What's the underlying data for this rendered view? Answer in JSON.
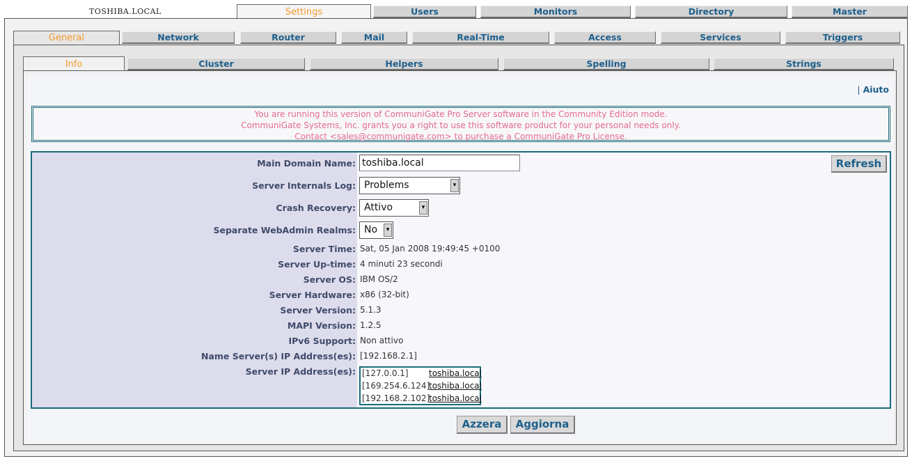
{
  "host": "TOSHIBA.LOCAL",
  "top_tabs": [
    {
      "label": "Settings",
      "active": true
    },
    {
      "label": "Users"
    },
    {
      "label": "Monitors"
    },
    {
      "label": "Directory"
    },
    {
      "label": "Master"
    }
  ],
  "second_tabs": [
    {
      "label": "General",
      "active": true
    },
    {
      "label": "Network"
    },
    {
      "label": "Router"
    },
    {
      "label": "Mail"
    },
    {
      "label": "Real-Time"
    },
    {
      "label": "Access"
    },
    {
      "label": "Services"
    },
    {
      "label": "Triggers"
    }
  ],
  "third_tabs": [
    {
      "label": "Info",
      "active": true
    },
    {
      "label": "Cluster"
    },
    {
      "label": "Helpers"
    },
    {
      "label": "Spelling"
    },
    {
      "label": "Strings"
    }
  ],
  "help": {
    "separator": "|",
    "label": "Aiuto"
  },
  "notice": {
    "line1": "You are running this version of CommuniGate Pro Server software in the Community Edition mode.",
    "line2": "CommuniGate Systems, Inc. grants you a right to use this software product for your personal needs only.",
    "line3": "Contact <sales@communigate.com> to purchase a CommuniGate Pro License."
  },
  "form": {
    "main_domain": {
      "label": "Main Domain Name:",
      "value": "toshiba.local"
    },
    "internals_log": {
      "label": "Server Internals Log:",
      "value": "Problems"
    },
    "crash_recovery": {
      "label": "Crash Recovery:",
      "value": "Attivo"
    },
    "webadmin_realms": {
      "label": "Separate WebAdmin Realms:",
      "value": "No"
    },
    "server_time": {
      "label": "Server Time:",
      "value": "Sat, 05 Jan 2008 19:49:45 +0100"
    },
    "uptime": {
      "label": "Server Up-time:",
      "value": "4 minuti 23 secondi"
    },
    "os": {
      "label": "Server OS:",
      "value": "IBM OS/2"
    },
    "hardware": {
      "label": "Server Hardware:",
      "value": "x86 (32-bit)"
    },
    "version": {
      "label": "Server Version:",
      "value": "5.1.3"
    },
    "mapi": {
      "label": "MAPI Version:",
      "value": "1.2.5"
    },
    "ipv6": {
      "label": "IPv6 Support:",
      "value": "Non attivo"
    },
    "dns": {
      "label": "Name Server(s) IP Address(es):",
      "value": "[192.168.2.1]"
    },
    "ips": {
      "label": "Server IP Address(es):",
      "rows": [
        {
          "addr": "[127.0.0.1]",
          "host": "toshiba.local"
        },
        {
          "addr": "[169.254.6.124]",
          "host": "toshiba.local"
        },
        {
          "addr": "[192.168.2.102]",
          "host": "toshiba.local"
        }
      ]
    }
  },
  "buttons": {
    "refresh": "Refresh",
    "reset": "Azzera",
    "update": "Aggiorna"
  }
}
